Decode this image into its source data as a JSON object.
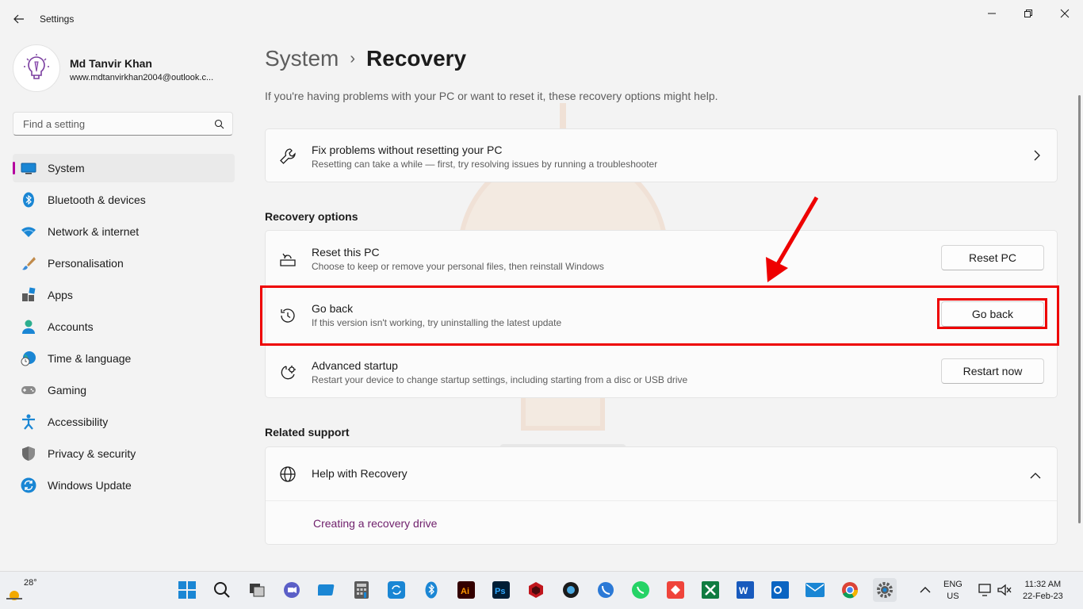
{
  "window": {
    "title": "Settings"
  },
  "profile": {
    "name": "Md Tanvir Khan",
    "email": "www.mdtanvirkhan2004@outlook.c..."
  },
  "search": {
    "placeholder": "Find a setting"
  },
  "nav": {
    "items": [
      {
        "label": "System",
        "icon": "system-icon",
        "active": true
      },
      {
        "label": "Bluetooth & devices",
        "icon": "bluetooth-icon"
      },
      {
        "label": "Network & internet",
        "icon": "wifi-icon"
      },
      {
        "label": "Personalisation",
        "icon": "brush-icon"
      },
      {
        "label": "Apps",
        "icon": "apps-icon"
      },
      {
        "label": "Accounts",
        "icon": "accounts-icon"
      },
      {
        "label": "Time & language",
        "icon": "globe-clock-icon"
      },
      {
        "label": "Gaming",
        "icon": "gamepad-icon"
      },
      {
        "label": "Accessibility",
        "icon": "accessibility-icon"
      },
      {
        "label": "Privacy & security",
        "icon": "shield-icon"
      },
      {
        "label": "Windows Update",
        "icon": "update-icon"
      }
    ]
  },
  "breadcrumb": {
    "parent": "System",
    "separator": "›",
    "current": "Recovery"
  },
  "intro": "If you're having problems with your PC or want to reset it, these recovery options might help.",
  "fix_card": {
    "title": "Fix problems without resetting your PC",
    "subtitle": "Resetting can take a while — first, try resolving issues by running a troubleshooter"
  },
  "recovery_options": {
    "heading": "Recovery options",
    "rows": [
      {
        "title": "Reset this PC",
        "subtitle": "Choose to keep or remove your personal files, then reinstall Windows",
        "button": "Reset PC"
      },
      {
        "title": "Go back",
        "subtitle": "If this version isn't working, try uninstalling the latest update",
        "button": "Go back"
      },
      {
        "title": "Advanced startup",
        "subtitle": "Restart your device to change startup settings, including starting from a disc or USB drive",
        "button": "Restart now"
      }
    ]
  },
  "related_support": {
    "heading": "Related support",
    "help_title": "Help with Recovery",
    "link": "Creating a recovery drive"
  },
  "taskbar": {
    "weather_temp": "28°",
    "lang_line1": "ENG",
    "lang_line2": "US",
    "time": "11:32 AM",
    "date": "22-Feb-23"
  },
  "colors": {
    "accent": "#b4009e",
    "highlight": "#e00000",
    "link": "#70216d"
  }
}
